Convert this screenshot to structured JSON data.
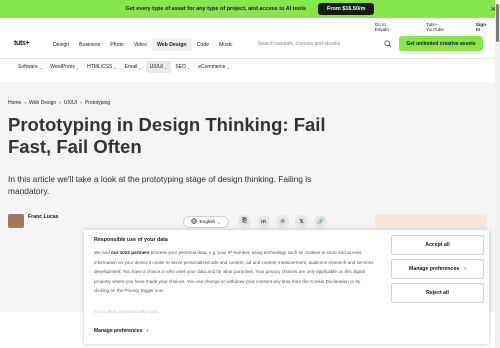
{
  "promo": {
    "text": "Get every type of asset for any type of project, and access to AI tools",
    "button": "From $16.50/m",
    "close_icon": "close-icon"
  },
  "topbar": {
    "goto": "Go to Envato",
    "tuts": "Tuts+ YouTube",
    "signin": "Sign In"
  },
  "logo": {
    "text": "tuts+"
  },
  "nav": {
    "items": [
      "Design",
      "Business",
      "Photo",
      "Video",
      "Web Design",
      "Code",
      "Music"
    ],
    "active": "Web Design"
  },
  "search": {
    "placeholder": "Search tutorials, courses and ebooks"
  },
  "cta": {
    "label": "Get unlimited creative assets"
  },
  "subnav": {
    "items": [
      {
        "label": "Software",
        "chevron": true
      },
      {
        "label": "WordPress",
        "chevron": true
      },
      {
        "label": "HTML/CSS",
        "chevron": true
      },
      {
        "label": "Email",
        "chevron": true
      },
      {
        "label": "UX/UI",
        "chevron": true,
        "active": true
      },
      {
        "label": "SEO",
        "chevron": true
      },
      {
        "label": "eCommerce",
        "chevron": true
      }
    ]
  },
  "breadcrumb": [
    "Home",
    "Web Design",
    "UX/UI",
    "Prototyping"
  ],
  "article": {
    "title": "Prototyping in Design Thinking: Fail Fast, Fail Often",
    "lede": "In this article we'll take a look at the prototyping stage of design thinking. Failing is mandatory.",
    "author": "Franc Lucas",
    "language": "English"
  },
  "shares": [
    {
      "icon": "copy-link-icon",
      "glyph": "⎘"
    },
    {
      "icon": "linkedin-icon",
      "glyph": "in"
    },
    {
      "icon": "pinterest-icon",
      "glyph": "℗"
    },
    {
      "icon": "x-icon",
      "glyph": "𝕏"
    },
    {
      "icon": "link-icon",
      "glyph": "🔗"
    }
  ],
  "consent": {
    "title": "Responsible use of your data",
    "body_pre": "We and ",
    "body_bold": "our 1022 partners",
    "body_post": " process your personal data, e.g. your IP-number, using technology such as cookies to store and access information on your device in order to serve personalized ads and content, ad and content measurement, audience research and services development. You have a choice in who uses your data and for what purposes. Your privacy choices are only applicable on this digital property where you have made your choices. You can change or withdraw your consent any time from the Cookie Declaration or by clicking on the Privacy trigger icon.",
    "faded": "If you allow, personal data may...",
    "manage_link": "Manage preferences",
    "accept": "Accept all",
    "manage_button": "Manage preferences",
    "reject": "Reject all"
  }
}
